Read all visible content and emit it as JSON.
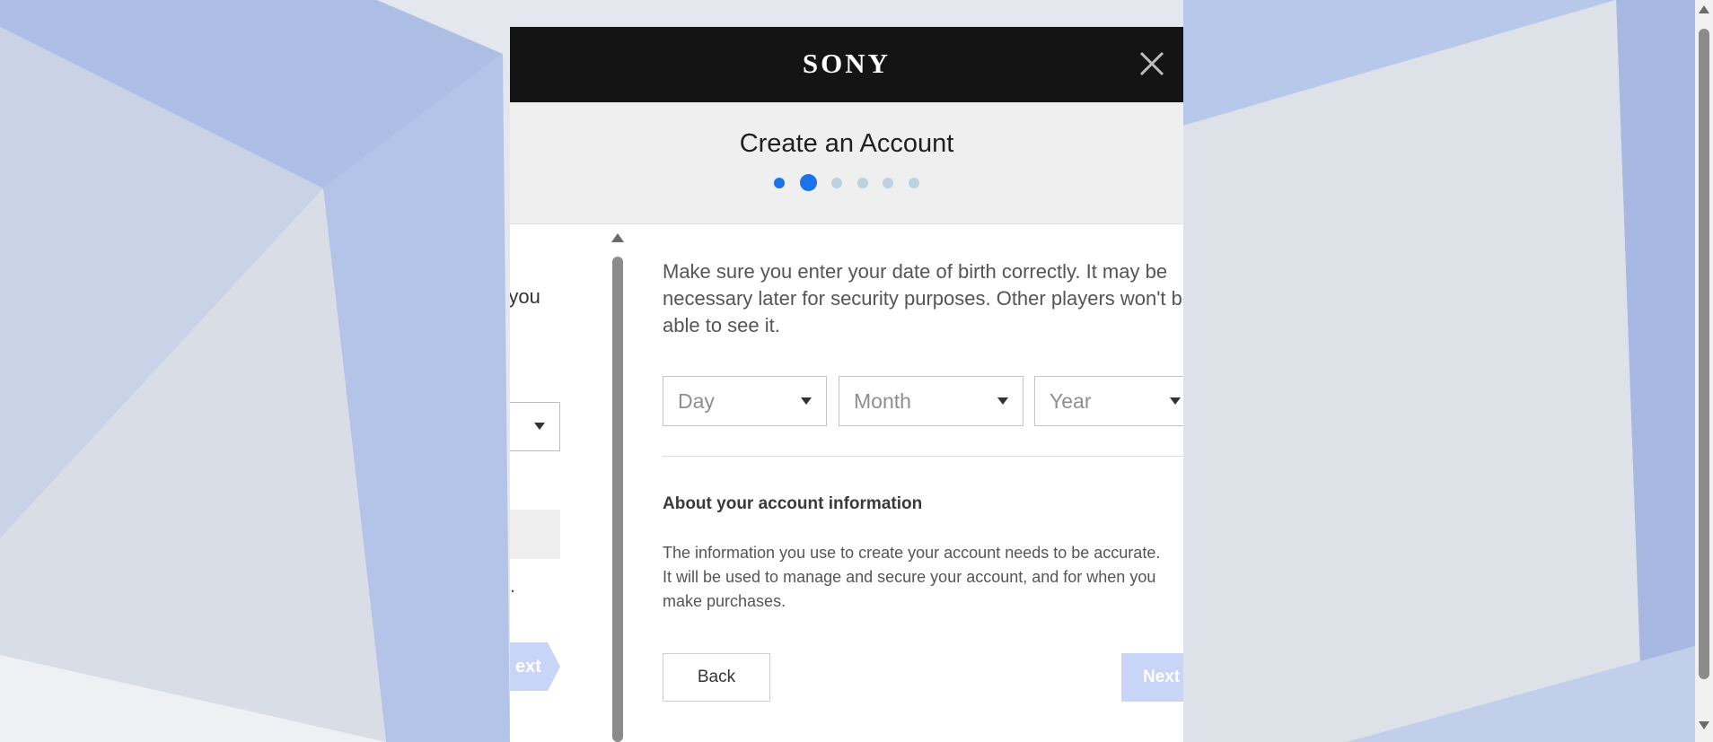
{
  "header": {
    "logo_text": "SONY",
    "close_icon": "close-icon"
  },
  "title": "Create an Account",
  "progress": {
    "total_steps": 6,
    "current_step": 2
  },
  "left_pane": {
    "text_fragment": "you",
    "dot": ".",
    "next_label_fragment": "ext"
  },
  "form": {
    "dob_note": "Make sure you enter your date of birth correctly. It may be necessary later for security purposes. Other players won't be able to see it.",
    "day_placeholder": "Day",
    "month_placeholder": "Month",
    "year_placeholder": "Year",
    "about_title": "About your account information",
    "about_text_line1": "The information you use to create your account needs to be accurate.",
    "about_text_line2": "It will be used to manage and secure your account, and for when you",
    "about_text_line3": "make purchases."
  },
  "buttons": {
    "back_label": "Back",
    "next_label": "Next"
  },
  "colors": {
    "header_bg": "#141414",
    "accent": "#1a73e8",
    "next_disabled": "#c9d5f6"
  }
}
